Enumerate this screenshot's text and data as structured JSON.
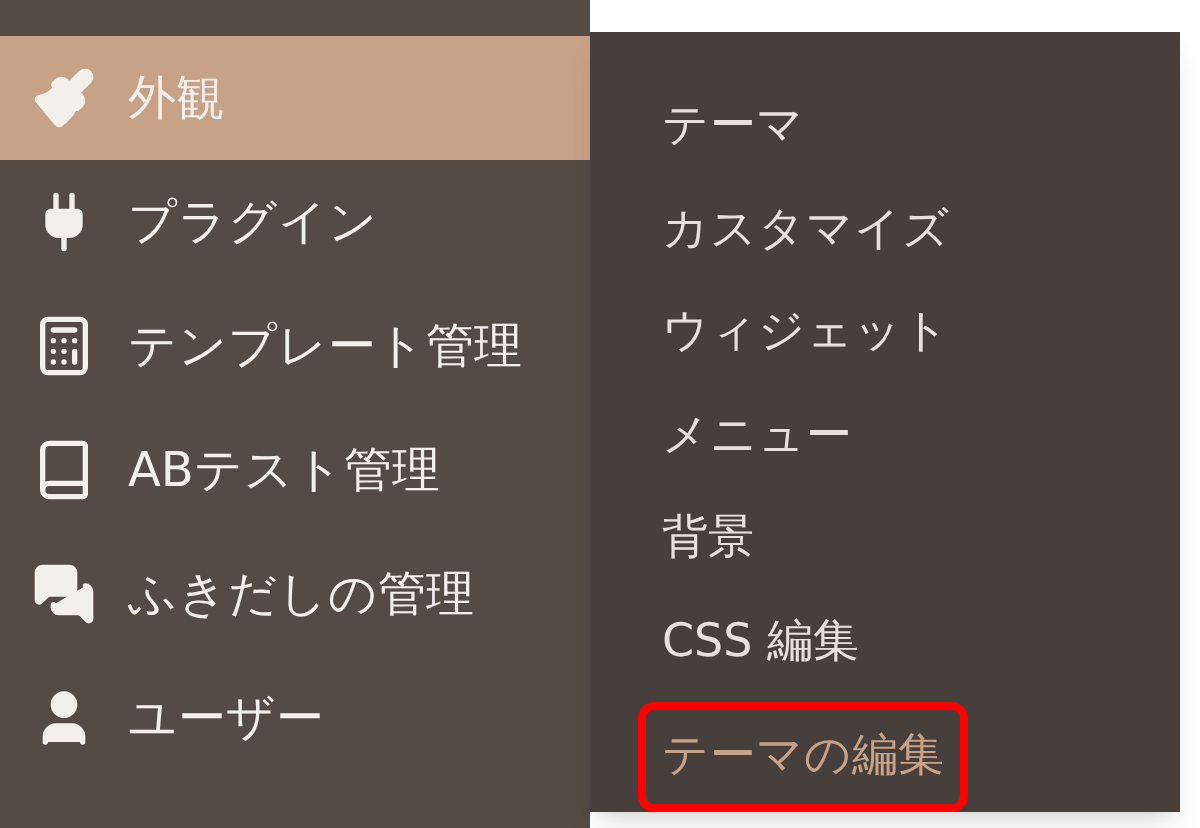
{
  "sidebar": {
    "items": [
      {
        "label": "外観",
        "selected": true
      },
      {
        "label": "プラグイン",
        "selected": false
      },
      {
        "label": "テンプレート管理",
        "selected": false
      },
      {
        "label": "ABテスト管理",
        "selected": false
      },
      {
        "label": "ふきだしの管理",
        "selected": false
      },
      {
        "label": "ユーザー",
        "selected": false
      }
    ]
  },
  "submenu": {
    "items": [
      {
        "label": "テーマ",
        "selected": false,
        "outlined": false
      },
      {
        "label": "カスタマイズ",
        "selected": false,
        "outlined": false
      },
      {
        "label": "ウィジェット",
        "selected": false,
        "outlined": false
      },
      {
        "label": "メニュー",
        "selected": false,
        "outlined": false
      },
      {
        "label": "背景",
        "selected": false,
        "outlined": false
      },
      {
        "label": "CSS 編集",
        "selected": false,
        "outlined": false
      },
      {
        "label": "テーマの編集",
        "selected": true,
        "outlined": true
      }
    ]
  }
}
